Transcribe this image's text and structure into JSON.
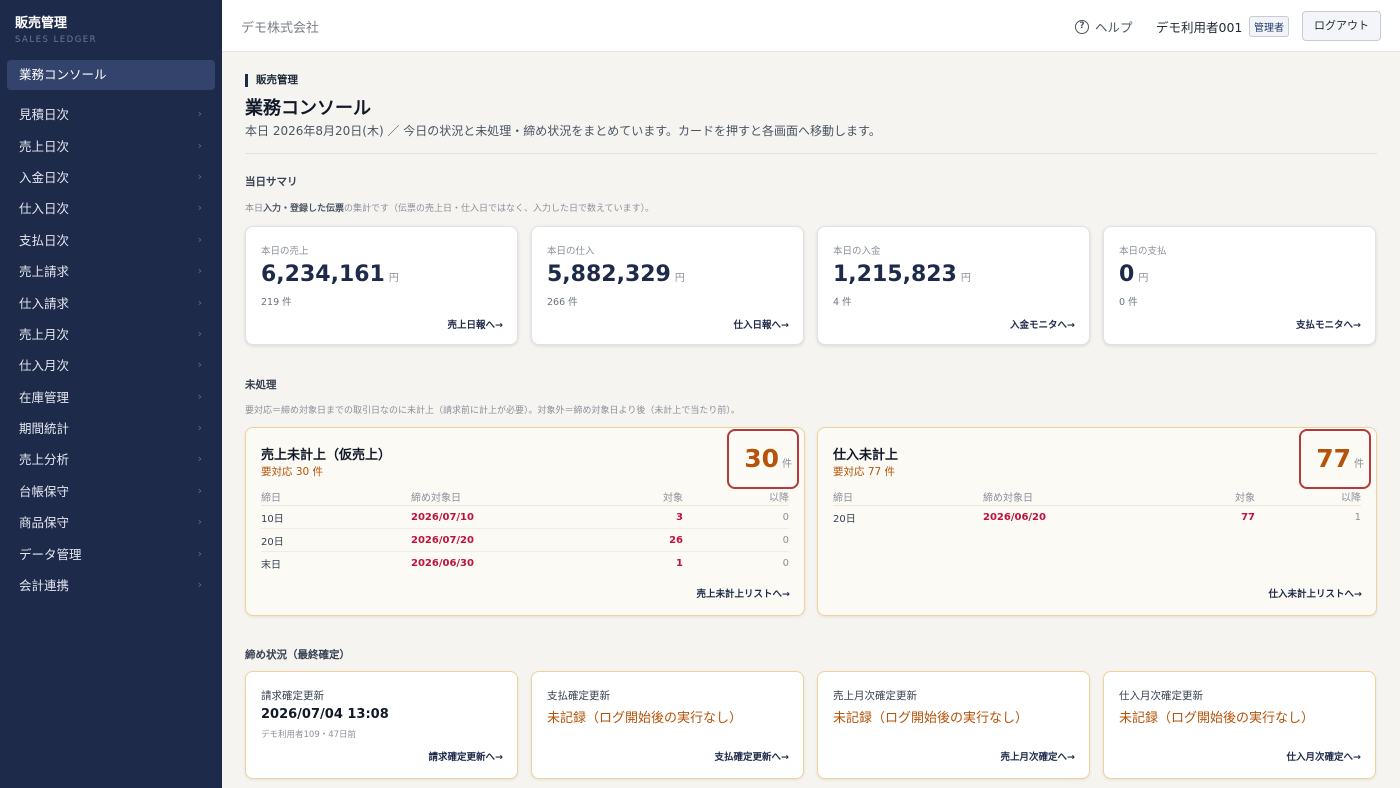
{
  "sidebar": {
    "brand_title": "販売管理",
    "brand_sub": "SALES LEDGER",
    "active": "業務コンソール",
    "items": [
      {
        "label": "見積日次"
      },
      {
        "label": "売上日次"
      },
      {
        "label": "入金日次"
      },
      {
        "label": "仕入日次"
      },
      {
        "label": "支払日次"
      },
      {
        "label": "売上請求"
      },
      {
        "label": "仕入請求"
      },
      {
        "label": "売上月次"
      },
      {
        "label": "仕入月次"
      },
      {
        "label": "在庫管理"
      },
      {
        "label": "期間統計"
      },
      {
        "label": "売上分析"
      },
      {
        "label": "台帳保守"
      },
      {
        "label": "商品保守"
      },
      {
        "label": "データ管理"
      },
      {
        "label": "会計連携"
      }
    ]
  },
  "header": {
    "company": "デモ株式会社",
    "help_label": "ヘルプ",
    "user_name": "デモ利用者001",
    "role": "管理者",
    "logout_label": "ログアウト"
  },
  "page": {
    "breadcrumb": "販売管理",
    "title": "業務コンソール",
    "description": "本日 2026年8月20日(木) ／ 今日の状況と未処理・締め状況をまとめています。カードを押すと各画面へ移動します。"
  },
  "summary": {
    "title": "当日サマリ",
    "note_prefix": "本日",
    "note_bold": "入力・登録した伝票",
    "note_suffix": "の集計です（伝票の売上日・仕入日ではなく、入力した日で数えています）。",
    "yen": "円",
    "cards": [
      {
        "label": "本日の売上",
        "value": "6,234,161",
        "count": "219 件",
        "link": "売上日報へ→"
      },
      {
        "label": "本日の仕入",
        "value": "5,882,329",
        "count": "266 件",
        "link": "仕入日報へ→"
      },
      {
        "label": "本日の入金",
        "value": "1,215,823",
        "count": "4 件",
        "link": "入金モニタへ→"
      },
      {
        "label": "本日の支払",
        "value": "0",
        "count": "0 件",
        "link": "支払モニタへ→"
      }
    ]
  },
  "pending": {
    "title": "未処理",
    "note": "要対応＝締め対象日までの取引日なのに未計上（請求前に計上が必要）。対象外＝締め対象日より後（未計上で当たり前）。",
    "unit": "件",
    "headers": {
      "close_day": "締日",
      "target_date": "締め対象日",
      "target": "対象",
      "after": "以降"
    },
    "cards": [
      {
        "title": "売上未計上（仮売上）",
        "sub": "要対応 30 件",
        "count": "30",
        "rows": [
          {
            "close_day": "10日",
            "target_date": "2026/07/10",
            "target": "3",
            "after": "0"
          },
          {
            "close_day": "20日",
            "target_date": "2026/07/20",
            "target": "26",
            "after": "0"
          },
          {
            "close_day": "末日",
            "target_date": "2026/06/30",
            "target": "1",
            "after": "0"
          }
        ],
        "link": "売上未計上リストへ→"
      },
      {
        "title": "仕入未計上",
        "sub": "要対応 77 件",
        "count": "77",
        "rows": [
          {
            "close_day": "20日",
            "target_date": "2026/06/20",
            "target": "77",
            "after": "1"
          }
        ],
        "link": "仕入未計上リストへ→"
      }
    ]
  },
  "closing": {
    "title": "締め状況（最終確定）",
    "cards": [
      {
        "label": "請求確定更新",
        "value": "2026/07/04 13:08",
        "meta": "デモ利用者109・47日前",
        "link": "請求確定更新へ→"
      },
      {
        "label": "支払確定更新",
        "value": "未記録（ログ開始後の実行なし）",
        "meta": "",
        "link": "支払確定更新へ→"
      },
      {
        "label": "売上月次確定更新",
        "value": "未記録（ログ開始後の実行なし）",
        "meta": "",
        "link": "売上月次確定へ→"
      },
      {
        "label": "仕入月次確定更新",
        "value": "未記録（ログ開始後の実行なし）",
        "meta": "",
        "link": "仕入月次確定へ→"
      }
    ]
  }
}
